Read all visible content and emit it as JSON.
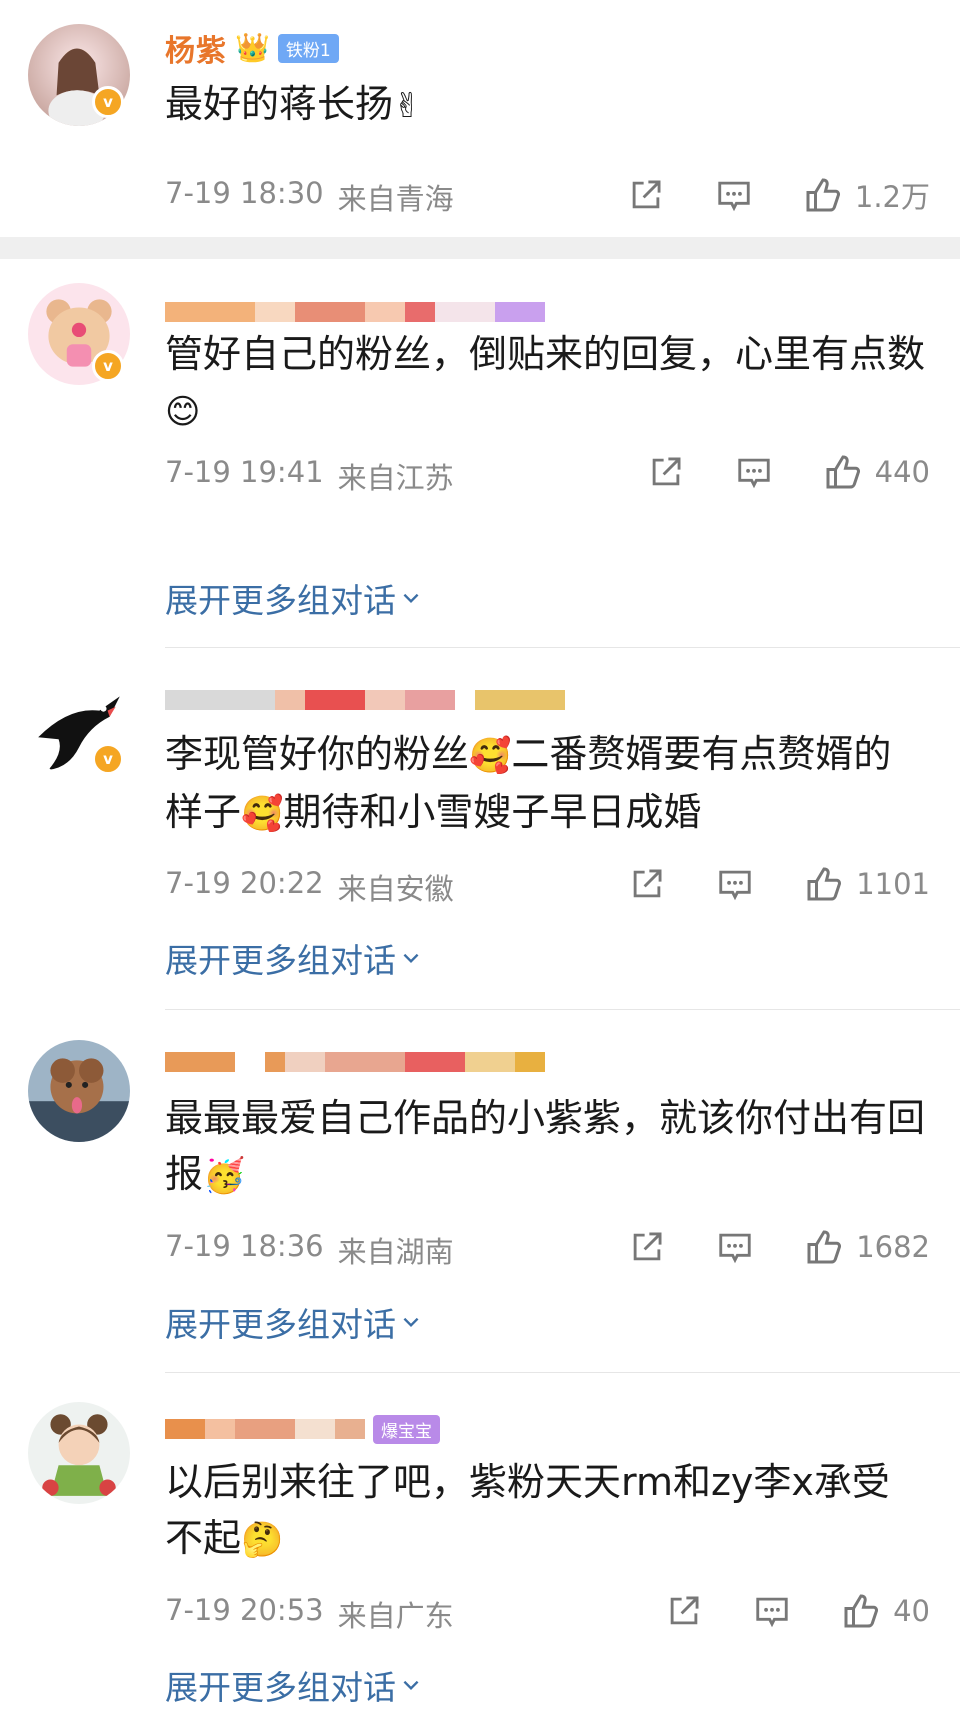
{
  "top_comment": {
    "name": "杨紫",
    "fan_badge": "铁粉1",
    "text": "最好的蒋长扬",
    "emoji": "✌",
    "time": "7-19 18:30",
    "location": "来自青海",
    "likes": "1.2万"
  },
  "expand_label": "展开更多组对话",
  "replies": [
    {
      "text": "管好自己的粉丝，倒贴来的回复，心里有点数",
      "emoji": "😊",
      "time": "7-19 19:41",
      "location": "来自江苏",
      "likes": "440"
    },
    {
      "text_a": "李现管好你的粉丝",
      "text_b": "二番赘婿要有点赘婿的样子",
      "text_c": "期待和小雪嫂子早日成婚",
      "emoji": "🥰",
      "time": "7-19 20:22",
      "location": "来自安徽",
      "likes": "1101"
    },
    {
      "text": "最最最爱自己作品的小紫紫，就该你付出有回报",
      "emoji": "🥳",
      "time": "7-19 18:36",
      "location": "来自湖南",
      "likes": "1682"
    },
    {
      "text": "以后别来往了吧，紫粉天天rm和zy李x承受不起",
      "emoji": "🤔",
      "badge": "爆宝宝",
      "time": "7-19 20:53",
      "location": "来自广东",
      "likes": "40"
    }
  ],
  "colors": {
    "name": "#e8762b",
    "link": "#3b6ea5",
    "meta": "#8a8a8a",
    "vip": "#f5a623"
  },
  "icons": {
    "share": "share-icon",
    "comment": "comment-icon",
    "like": "thumbs-up-icon"
  }
}
